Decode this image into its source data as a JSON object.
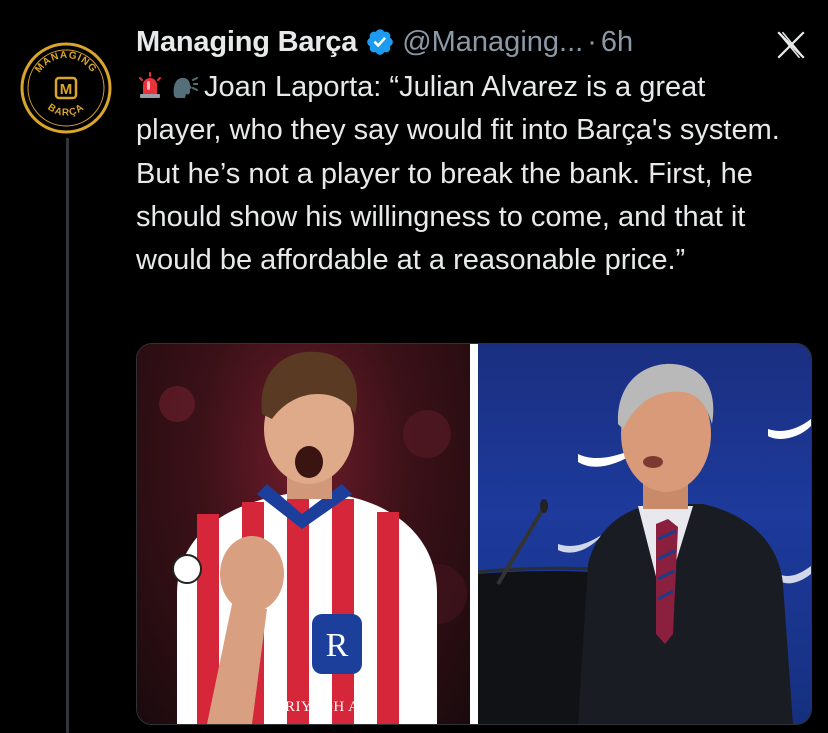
{
  "tweet": {
    "author_name": "Managing Barça",
    "handle": "@Managing...",
    "separator": "·",
    "time": "6h",
    "text": "Joan Laporta: “Julian Alvarez is a great player, who they say would fit into Barça's system. But he’s not a player to break the bank. First, he should show his willingness to come, and that it would be affordable at a reasonable price.”",
    "emojis": [
      "siren-emoji",
      "speaking-head-emoji"
    ]
  },
  "avatar": {
    "ring_text_top": "MANAGING",
    "ring_text_bottom": "BARÇA",
    "monogram": "M",
    "color": "#d9a52b"
  },
  "media": {
    "left_caption": "RIYADH AIR",
    "left_description_icon": "player-photo",
    "right_description_icon": "speaker-photo"
  },
  "colors": {
    "background": "#000000",
    "text": "#e7e9ea",
    "muted": "#8b98a5",
    "verified": "#1d9bf0",
    "accent": "#d9a52b"
  },
  "icons": {
    "verified": "verified-badge-icon",
    "close": "x-logo-icon"
  }
}
